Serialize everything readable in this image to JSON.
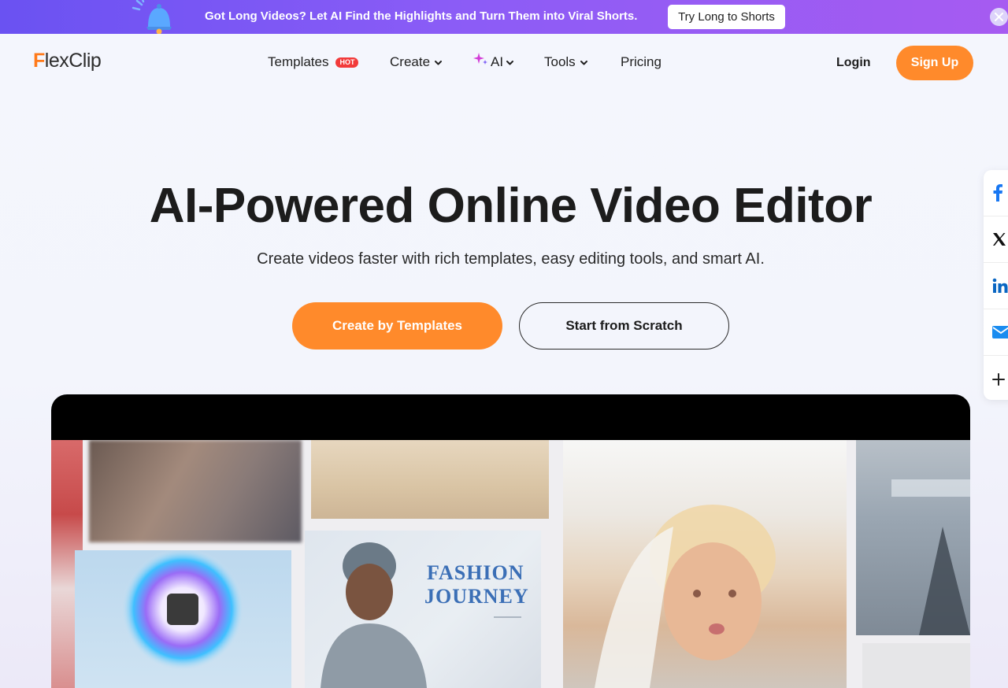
{
  "promo": {
    "text": "Got Long Videos? Let AI Find the Highlights and Turn Them into Viral Shorts.",
    "button_label": "Try Long to Shorts"
  },
  "nav": {
    "logo_text_rest": "lexClip",
    "logo_letter": "F",
    "items": [
      {
        "label": "Templates",
        "badge": "HOT"
      },
      {
        "label": "Create"
      },
      {
        "label": "AI"
      },
      {
        "label": "Tools"
      },
      {
        "label": "Pricing"
      }
    ],
    "login_label": "Login",
    "signup_label": "Sign Up"
  },
  "hero": {
    "title": "AI-Powered Online Video Editor",
    "subtitle": "Create videos faster with rich templates, easy editing tools, and smart AI.",
    "primary_cta": "Create by Templates",
    "secondary_cta": "Start from Scratch"
  },
  "share": {
    "icons": [
      "facebook-icon",
      "x-icon",
      "linkedin-icon",
      "email-icon",
      "plus-icon"
    ]
  },
  "preview": {
    "fashion_line1": "FASHION",
    "fashion_line2": "JOURNEY"
  },
  "colors": {
    "accent_orange": "#ff8a2b",
    "promo_purple": "#7b57f4",
    "hot_red": "#f23a3a"
  }
}
